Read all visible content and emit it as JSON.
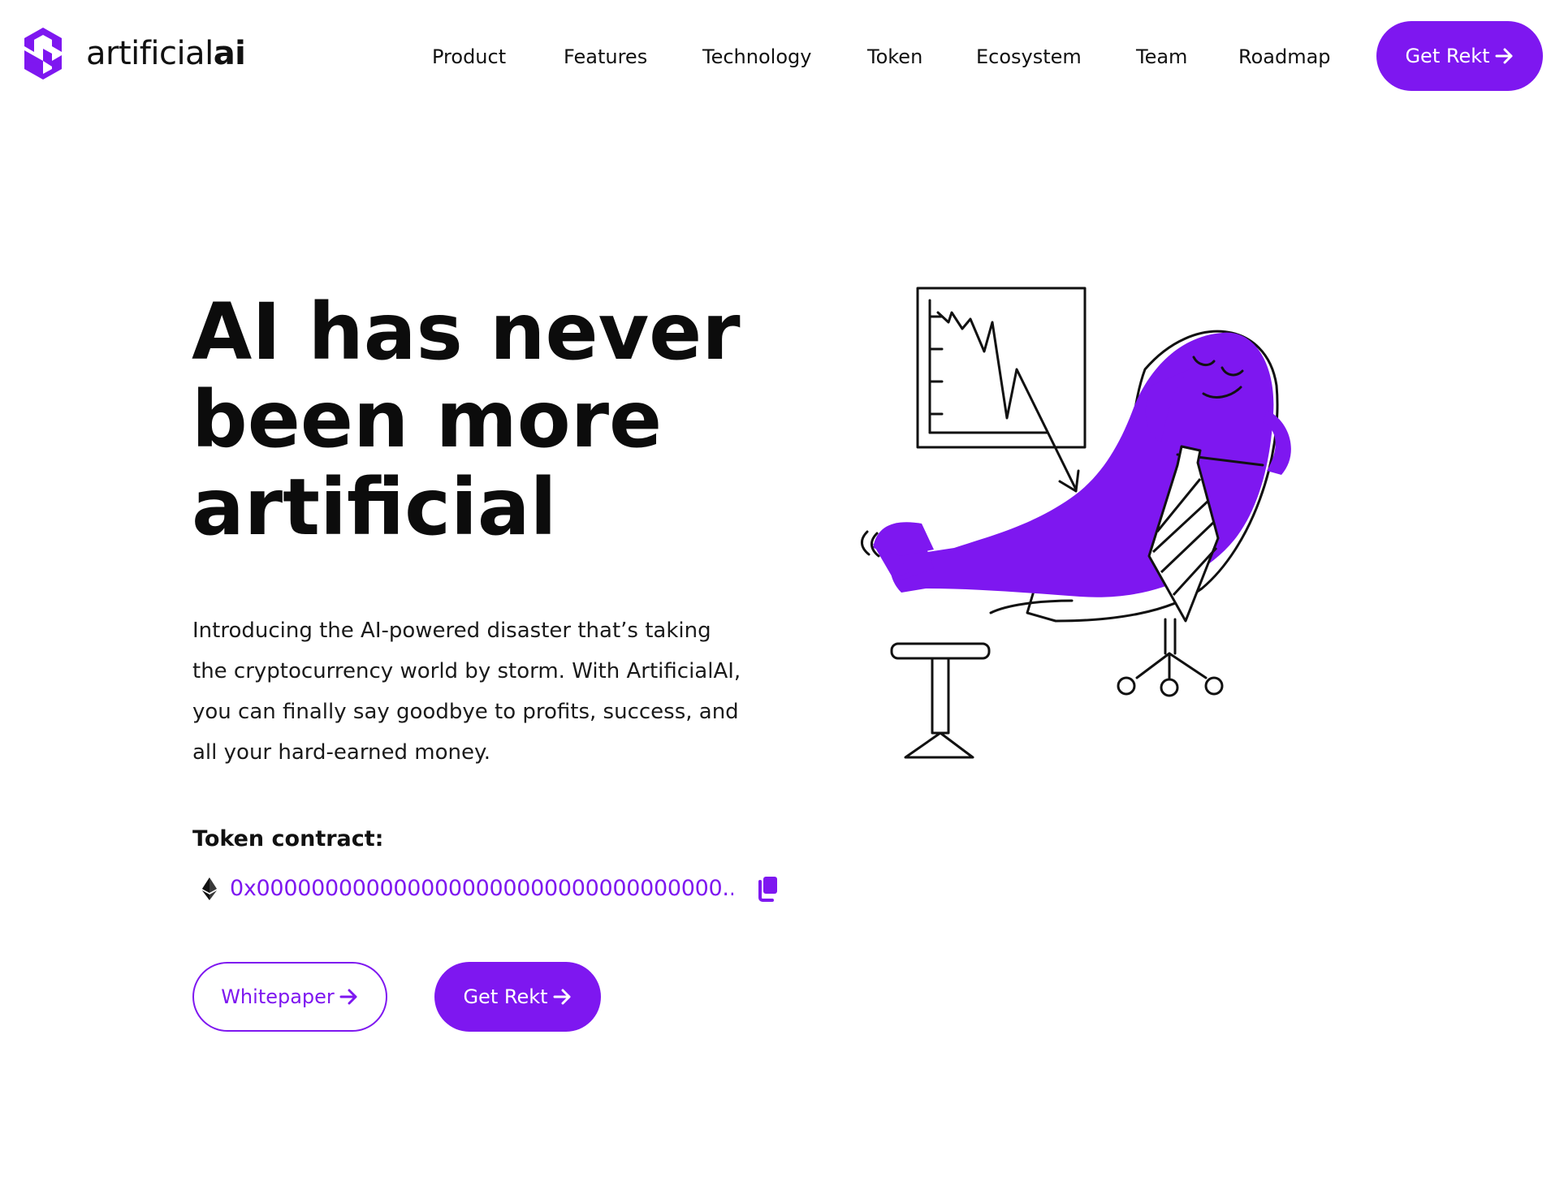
{
  "brand": {
    "name_light": "artificial",
    "name_bold": "ai",
    "accent_color": "#7e17f0"
  },
  "nav": {
    "items": [
      "Product",
      "Features",
      "Technology",
      "Token",
      "Ecosystem",
      "Team",
      "Roadmap"
    ],
    "cta_label": "Get Rekt"
  },
  "hero": {
    "title_lines": [
      "AI has never",
      "been more",
      "artificial"
    ],
    "description_lines": [
      "Introducing the AI-powered disaster that’s taking",
      "the cryptocurrency world by storm. With ArtificialAI,",
      "you can finally say goodbye to profits, success, and",
      "all your hard-earned money."
    ],
    "token_label": "Token contract:",
    "contract_address": "0x0000000000000000000000000000000000...",
    "chain_icon": "ethereum-icon",
    "copy_icon": "copy-icon",
    "whitepaper_label": "Whitepaper",
    "cta_label": "Get Rekt"
  },
  "illustration": {
    "subject": "relaxing-purple-character-in-chair-with-falling-chart"
  }
}
